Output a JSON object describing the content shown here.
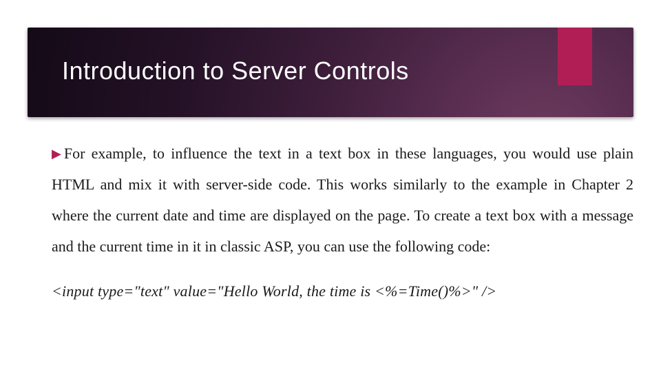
{
  "header": {
    "title": "Introduction to Server Controls"
  },
  "body": {
    "bullet_icon": "▶",
    "paragraph": "For example, to influence the text in a text box in these languages, you would use plain HTML and mix it with server-side code. This works similarly to the example in Chapter 2 where the current date and time are displayed on the page. To create a text box with a message and the current time in it in classic ASP, you can use the following code:",
    "code": "<input type=\"text\" value=\"Hello World, the time is <%=Time()%>\" />"
  },
  "colors": {
    "accent": "#b11e55"
  }
}
